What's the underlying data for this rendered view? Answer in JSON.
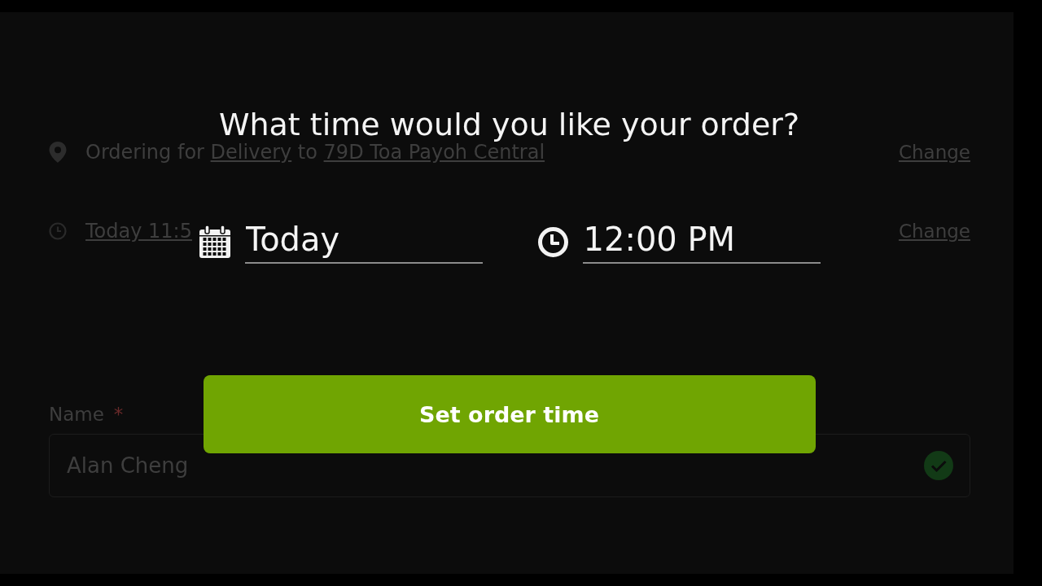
{
  "page": {
    "delivery": {
      "prefix": "Ordering for",
      "mode": "Delivery",
      "joiner": "to",
      "address": "79D Toa Payoh Central",
      "action": "Change"
    },
    "schedule": {
      "time": "Today 11:5",
      "action": "Change"
    },
    "name_field": {
      "label": "Name",
      "required_mark": "*",
      "value": "Alan Cheng",
      "valid": true
    }
  },
  "dialog": {
    "title": "What time would you like your order?",
    "date": {
      "value": "Today"
    },
    "time": {
      "value": "12:00 PM"
    },
    "button": "Set order time"
  }
}
